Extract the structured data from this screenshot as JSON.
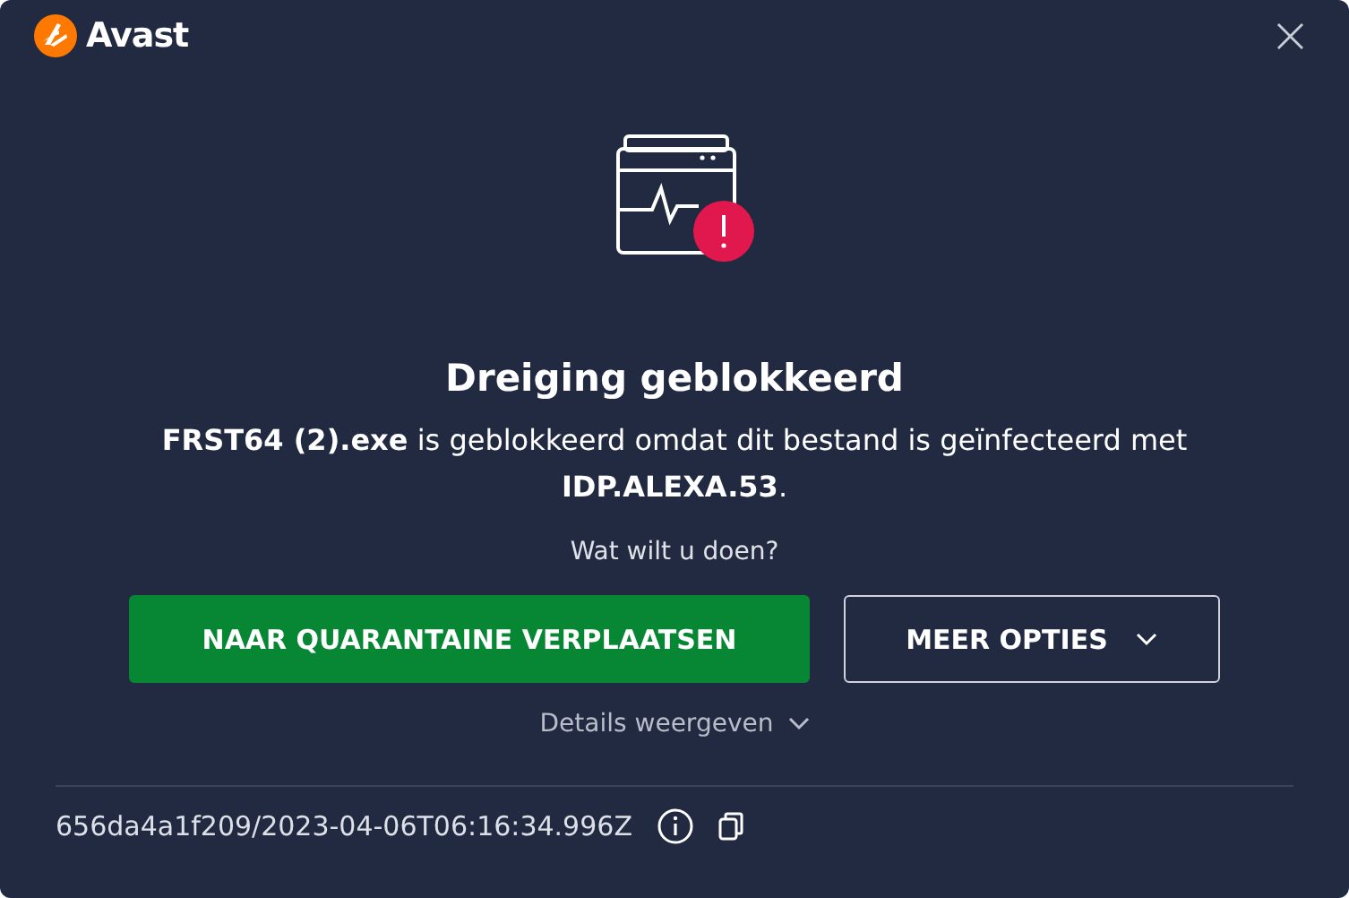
{
  "window": {
    "app_name": "Avast",
    "close": "×"
  },
  "alert": {
    "title": "Dreiging geblokkeerd",
    "message": "**FRST64 (2).exe** is geblokkeerd omdat dit bestand is geïnfecteerd met **IDP.ALEXA.53**.",
    "question": "Wat wilt u doen?"
  },
  "buttons": [
    {
      "label": "NAAR QUARANTAINE VERPLAATSEN",
      "kind": "primary"
    },
    {
      "label": "MEER OPTIES",
      "kind": "dropdown"
    }
  ],
  "details_link": "Details weergeven",
  "footer": {
    "id": "656da4a1f209/2023-04-06T06:16:34.996Z"
  }
}
